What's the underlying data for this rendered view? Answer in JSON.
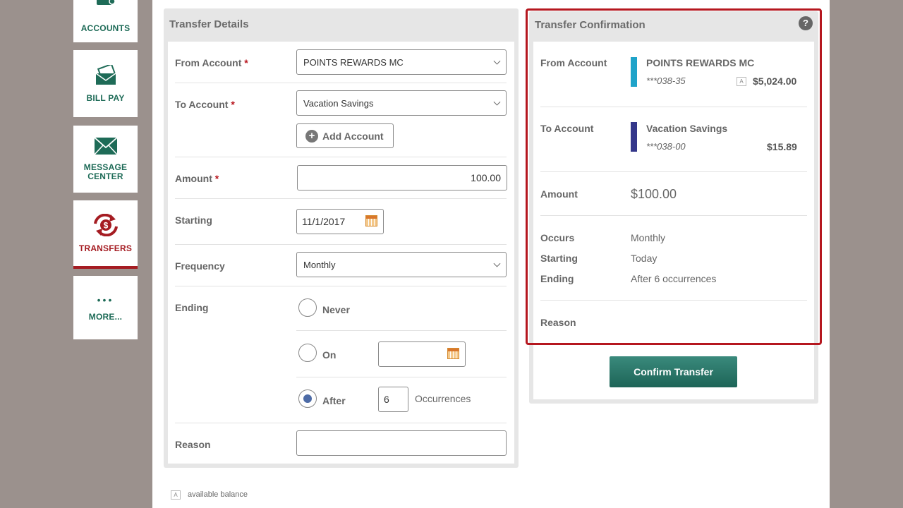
{
  "nav": {
    "accounts": "ACCOUNTS",
    "bill_pay": "BILL PAY",
    "message_center": "MESSAGE\nCENTER",
    "transfers": "TRANSFERS",
    "more": "MORE...",
    "more_dots": "•••"
  },
  "details": {
    "title": "Transfer Details",
    "from_label": "From Account",
    "from_value": "POINTS REWARDS MC",
    "to_label": "To Account",
    "to_value": "Vacation Savings",
    "add_account": "Add Account",
    "amount_label": "Amount",
    "amount_value": "100.00",
    "starting_label": "Starting",
    "starting_value": "11/1/2017",
    "frequency_label": "Frequency",
    "frequency_value": "Monthly",
    "ending_label": "Ending",
    "never": "Never",
    "on": "On",
    "on_value": "",
    "after": "After",
    "occurrences_value": "6",
    "occurrences_label": "Occurrences",
    "reason_label": "Reason",
    "reason_value": "",
    "required_mark": "*"
  },
  "confirmation": {
    "title": "Transfer Confirmation",
    "help": "?",
    "from_label": "From Account",
    "from_name": "POINTS REWARDS MC",
    "from_number": "***038-35",
    "from_balance_flag": "A",
    "from_balance": "$5,024.00",
    "to_label": "To Account",
    "to_name": "Vacation Savings",
    "to_number": "***038-00",
    "to_balance": "$15.89",
    "amount_label": "Amount",
    "amount_value": "$100.00",
    "occurs_label": "Occurs",
    "occurs_value": "Monthly",
    "starting_label": "Starting",
    "starting_value": "Today",
    "ending_label": "Ending",
    "ending_value": "After 6 occurrences",
    "reason_label": "Reason",
    "confirm_button": "Confirm Transfer"
  },
  "footnote": {
    "flag": "A",
    "text": "available balance"
  },
  "colors": {
    "from_account_bar": "#1fa3c9",
    "to_account_bar": "#34378a",
    "accent_red": "#b5171f",
    "nav_green": "#1e6b57"
  }
}
